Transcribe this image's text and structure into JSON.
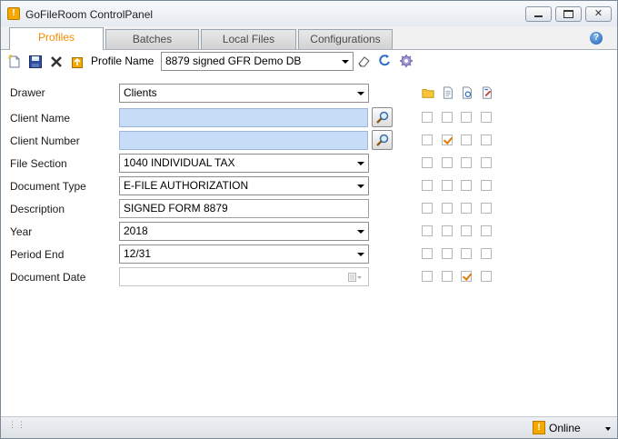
{
  "window": {
    "title": "GoFileRoom ControlPanel",
    "app_icon_glyph": "!",
    "minimize_label": "",
    "maximize_label": "",
    "close_label": "✕"
  },
  "tabs": [
    {
      "label": "Profiles",
      "active": true
    },
    {
      "label": "Batches",
      "active": false
    },
    {
      "label": "Local Files",
      "active": false
    },
    {
      "label": "Configurations",
      "active": false
    }
  ],
  "help": {
    "glyph": "?"
  },
  "toolbar": {
    "icons": [
      "new-document-icon",
      "save-icon",
      "delete-icon",
      "upload-icon"
    ],
    "profile_label": "Profile Name",
    "profile_value": "8879 signed GFR Demo DB",
    "right_icons": [
      "eraser-icon",
      "refresh-icon",
      "settings-gear-icon"
    ]
  },
  "form": {
    "drawer": {
      "label": "Drawer",
      "value": "Clients"
    },
    "client_name": {
      "label": "Client Name",
      "value": ""
    },
    "client_number": {
      "label": "Client Number",
      "value": ""
    },
    "file_section": {
      "label": "File Section",
      "value": "1040 INDIVIDUAL TAX"
    },
    "document_type": {
      "label": "Document Type",
      "value": "E-FILE AUTHORIZATION"
    },
    "description": {
      "label": "Description",
      "value": "SIGNED FORM 8879"
    },
    "year": {
      "label": "Year",
      "value": "2018"
    },
    "period_end": {
      "label": "Period End",
      "value": "12/31"
    },
    "document_date": {
      "label": "Document Date",
      "value": ""
    }
  },
  "column_icons": [
    "folder-icon",
    "document-icon",
    "document-refresh-icon",
    "document-edit-icon"
  ],
  "checkbox_rows": [
    {
      "row": "client-name",
      "checked": [
        false,
        false,
        false,
        false
      ]
    },
    {
      "row": "client-number",
      "checked": [
        false,
        true,
        false,
        false
      ]
    },
    {
      "row": "file-section",
      "checked": [
        false,
        false,
        false,
        false
      ]
    },
    {
      "row": "document-type",
      "checked": [
        false,
        false,
        false,
        false
      ]
    },
    {
      "row": "description",
      "checked": [
        false,
        false,
        false,
        false
      ]
    },
    {
      "row": "year",
      "checked": [
        false,
        false,
        false,
        false
      ]
    },
    {
      "row": "period-end",
      "checked": [
        false,
        false,
        false,
        false
      ]
    },
    {
      "row": "document-date",
      "checked": [
        false,
        false,
        true,
        false
      ]
    }
  ],
  "status": {
    "icon_glyph": "!",
    "text": "Online"
  },
  "colors": {
    "accent_orange": "#f28c00",
    "highlight_blue": "#c7dcf7",
    "check_orange": "#e07a00"
  }
}
